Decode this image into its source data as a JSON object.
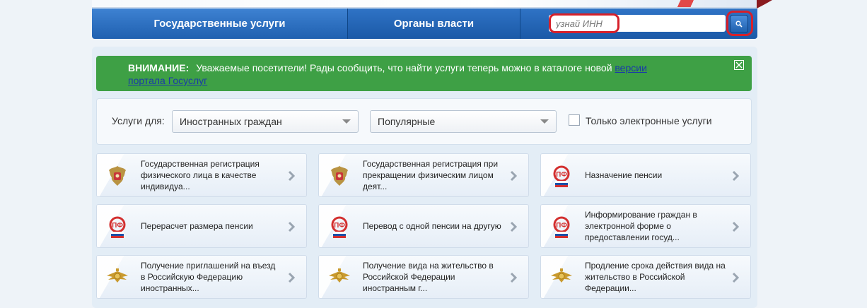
{
  "nav": {
    "tab_services": "Государственные услуги",
    "tab_authorities": "Органы власти",
    "search_placeholder": "узнай ИНН"
  },
  "notice": {
    "title": "ВНИМАНИЕ:",
    "text": "Уважаемые посетители! Рады сообщить, что найти услуги теперь можно в каталоге новой ",
    "link_text": "версии портала Госуслуг"
  },
  "filters": {
    "label": "Услуги для:",
    "audience_value": "Иностранных граждан",
    "sort_value": "Популярные",
    "electronic_only_label": "Только электронные услуги",
    "electronic_only_checked": false
  },
  "services": [
    {
      "label": "Государственная регистрация физического лица в качестве индивидуа...",
      "icon": "coat-of-arms-icon"
    },
    {
      "label": "Государственная регистрация при прекращении физическим лицом деят...",
      "icon": "coat-of-arms-icon"
    },
    {
      "label": "Назначение пенсии",
      "icon": "pension-fund-icon"
    },
    {
      "label": "Перерасчет размера пенсии",
      "icon": "pension-fund-icon"
    },
    {
      "label": "Перевод с одной пенсии на другую",
      "icon": "pension-fund-icon"
    },
    {
      "label": "Информирование граждан в электронной форме о предоставлении госуд...",
      "icon": "pension-fund-icon"
    },
    {
      "label": "Получение приглашений на въезд в Российскую Федерацию иностранных...",
      "icon": "eagle-emblem-icon"
    },
    {
      "label": "Получение вида на жительство в Российской Федерации иностранным г...",
      "icon": "eagle-emblem-icon"
    },
    {
      "label": "Продление срока действия вида на жительство в Российской Федерации...",
      "icon": "eagle-emblem-icon"
    }
  ],
  "colors": {
    "nav_blue": "#1f60b0",
    "notice_green": "#3ea045",
    "highlight_red": "#d6202a"
  }
}
